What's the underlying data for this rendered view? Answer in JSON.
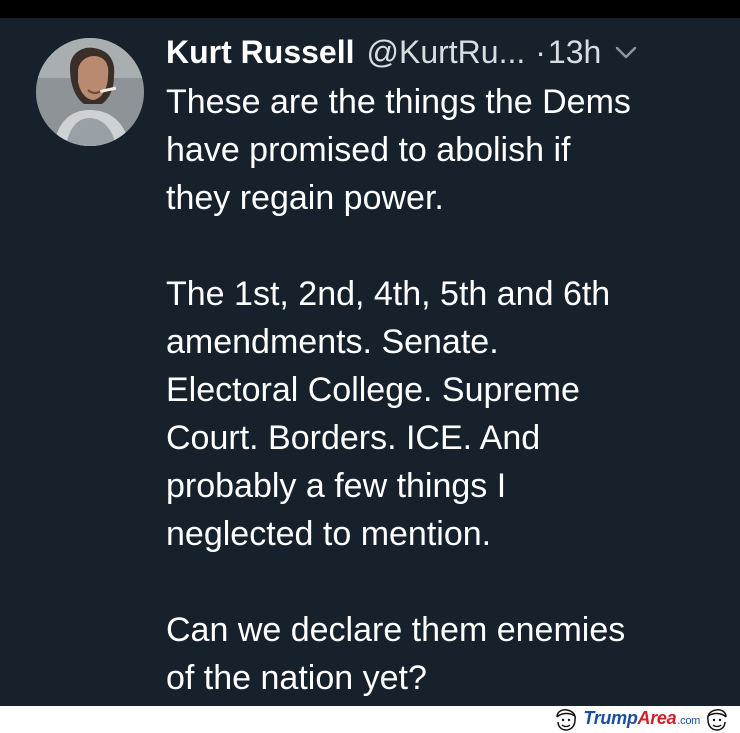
{
  "tweet": {
    "display_name": "Kurt Russell",
    "handle": "@KurtRu...",
    "separator": "·",
    "timestamp": "13h",
    "paragraphs": [
      [
        "These are the things the Dems",
        "have promised to abolish if",
        "they regain power."
      ],
      [
        "The 1st, 2nd, 4th, 5th and 6th",
        "amendments.  Senate.",
        "Electoral College.  Supreme",
        "Court.  Borders.  ICE.  And",
        "probably a few things I",
        "neglected to mention."
      ],
      [
        "Can we declare them enemies",
        "of the nation yet?"
      ]
    ]
  },
  "icons": {
    "avatar": "profile-photo",
    "menu": "chevron-down-icon",
    "watermark_face": "cartoon-face-icon"
  },
  "watermark": {
    "part1": "Trump",
    "part2": "Area",
    "part3": ".com"
  },
  "colors": {
    "background": "#17212c",
    "frame": "#000000",
    "text": "#ffffff",
    "secondary_text": "#d9dde1",
    "watermark_blue": "#1b4fa0",
    "watermark_red": "#d0202a"
  }
}
